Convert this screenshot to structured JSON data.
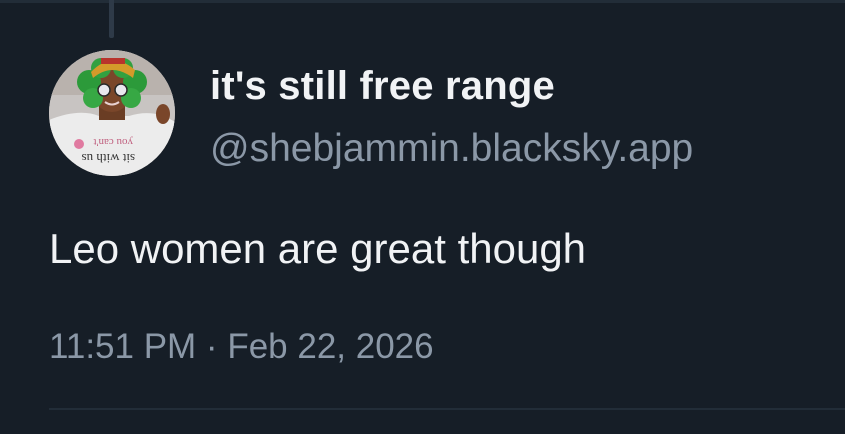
{
  "post": {
    "author": {
      "display_name": "it's still free range",
      "handle": "@shebjammin.blacksky.app",
      "avatar_shirt_text_line1": "you can't",
      "avatar_shirt_text_line2": "sit with us"
    },
    "text": "Leo women are great though",
    "timestamp": "11:51 PM · Feb 22, 2026"
  },
  "colors": {
    "background": "#161e27",
    "primary_text": "#f1f3f5",
    "secondary_text": "#8b98a7",
    "divider": "#222d38"
  },
  "icons": {
    "avatar": "profile-photo"
  }
}
